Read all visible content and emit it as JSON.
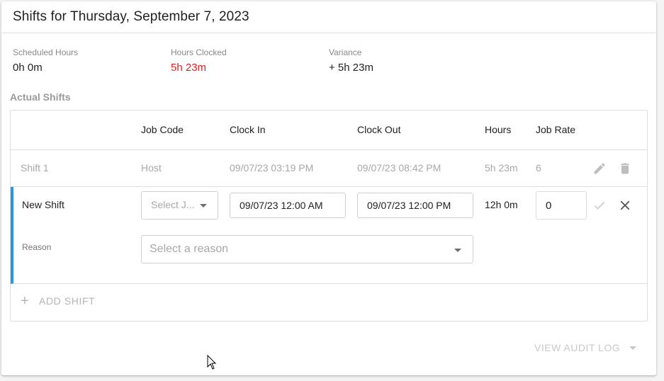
{
  "header": {
    "title": "Shifts for Thursday, September 7, 2023"
  },
  "summary": {
    "scheduled": {
      "label": "Scheduled Hours",
      "value": "0h 0m"
    },
    "clocked": {
      "label": "Hours Clocked",
      "value": "5h 23m",
      "color": "#e02020"
    },
    "variance": {
      "label": "Variance",
      "value": "+ 5h 23m"
    }
  },
  "section_label": "Actual Shifts",
  "table": {
    "columns": [
      "",
      "Job Code",
      "Clock In",
      "Clock Out",
      "Hours",
      "Job Rate"
    ],
    "rows": [
      {
        "name": "Shift 1",
        "job_code": "Host",
        "clock_in": "09/07/23  03:19 PM",
        "clock_out": "09/07/23  08:42 PM",
        "hours": "5h 23m",
        "job_rate": "6",
        "actions": [
          "pencil-icon",
          "trash-icon"
        ]
      }
    ],
    "new_shift": {
      "name": "New Shift",
      "job_code_placeholder": "Select J...",
      "clock_in": "09/07/23  12:00 AM",
      "clock_out": "09/07/23  12:00 PM",
      "hours": "12h 0m",
      "job_rate": "0",
      "reason_label": "Reason",
      "reason_placeholder": "Select a reason",
      "actions": [
        "check-icon",
        "close-icon"
      ],
      "accent_color": "#2b96d8"
    },
    "add_shift_label": "ADD SHIFT"
  },
  "footer": {
    "audit_log_label": "VIEW AUDIT LOG"
  }
}
